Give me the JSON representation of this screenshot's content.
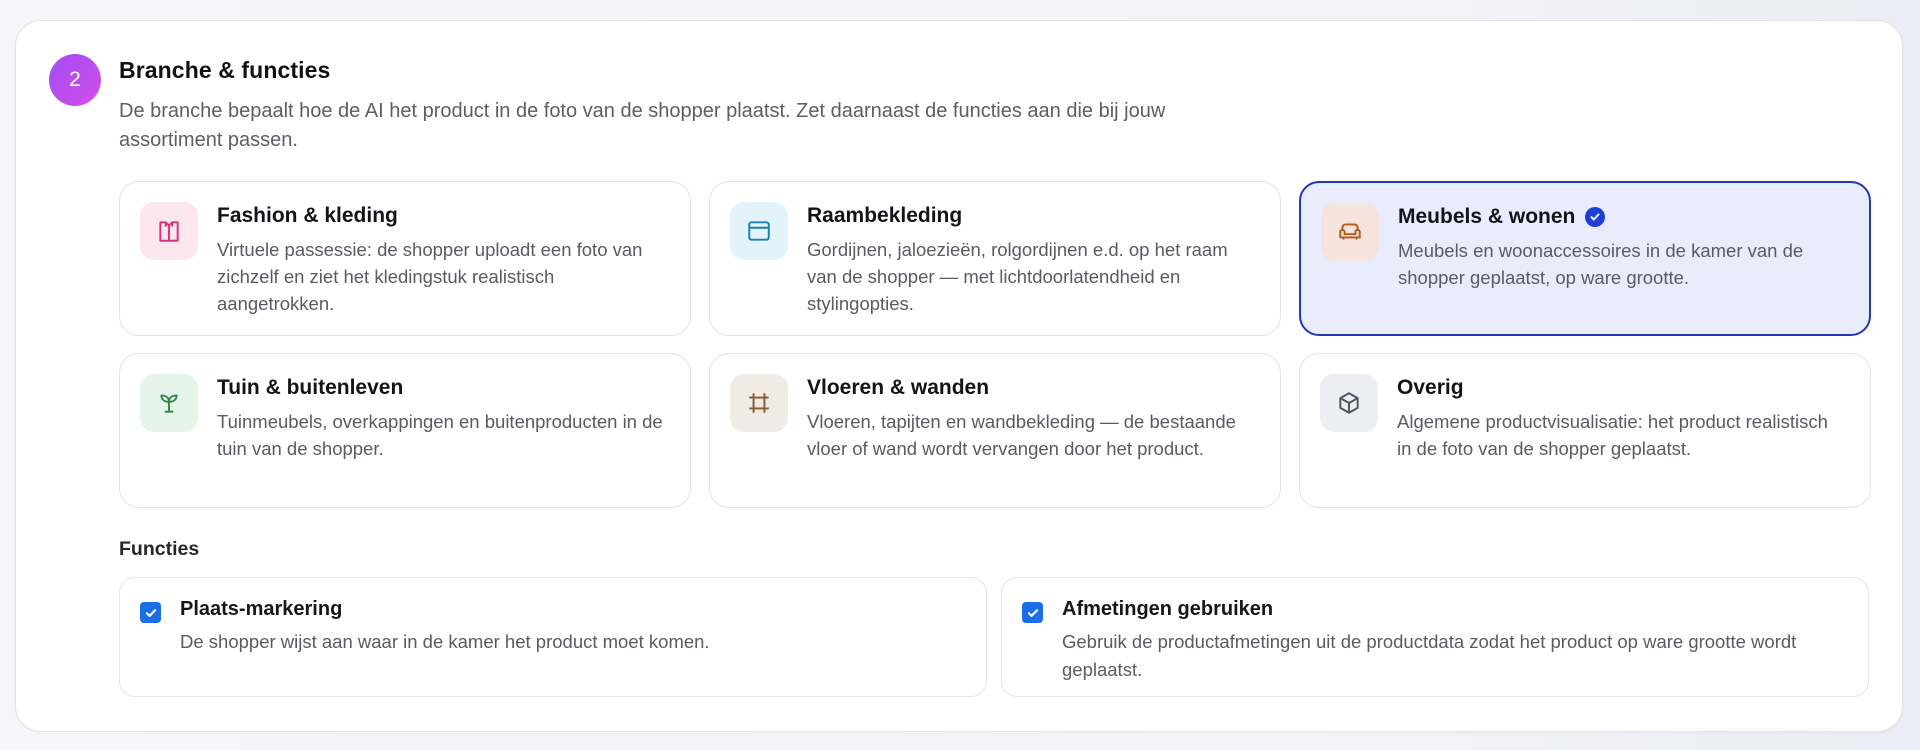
{
  "step": {
    "number": "2"
  },
  "section": {
    "title": "Branche & functies",
    "description": "De branche bepaalt hoe de AI het product in de foto van de shopper plaatst. Zet daarnaast de functies aan die bij jouw assortiment passen."
  },
  "branches": [
    {
      "id": "fashion",
      "title": "Fashion & kleding",
      "description": "Virtuele passessie: de shopper uploadt een foto van zichzelf en ziet het kledingstuk realistisch aangetrokken.",
      "icon": "shirt-icon",
      "icon_color": "#d6337a",
      "icon_bg": "#fde7ef",
      "selected": false
    },
    {
      "id": "raambekleding",
      "title": "Raambekleding",
      "description": "Gordijnen, jaloezieën, rolgordijnen e.d. op het raam van de shopper — met lichtdoorlatendheid en stylingopties.",
      "icon": "window-icon",
      "icon_color": "#1b7fb5",
      "icon_bg": "#e3f3fb",
      "selected": false
    },
    {
      "id": "meubels",
      "title": "Meubels & wonen",
      "description": "Meubels en woonaccessoires in de kamer van de shopper geplaatst, op ware grootte.",
      "icon": "sofa-icon",
      "icon_color": "#b45a1e",
      "icon_bg": "#f4e4dc",
      "selected": true
    },
    {
      "id": "tuin",
      "title": "Tuin & buitenleven",
      "description": "Tuinmeubels, overkappingen en buitenproducten in de tuin van de shopper.",
      "icon": "sprout-icon",
      "icon_color": "#2c8a4a",
      "icon_bg": "#e6f5ea",
      "selected": false
    },
    {
      "id": "vloeren",
      "title": "Vloeren & wanden",
      "description": "Vloeren, tapijten en wandbekleding — de bestaande vloer of wand wordt vervangen door het product.",
      "icon": "frame-icon",
      "icon_color": "#8a5a33",
      "icon_bg": "#f1ebe5",
      "selected": false
    },
    {
      "id": "overig",
      "title": "Overig",
      "description": "Algemene productvisualisatie: het product realistisch in de foto van de shopper geplaatst.",
      "icon": "box-icon",
      "icon_color": "#4e5461",
      "icon_bg": "#eceef1",
      "selected": false
    }
  ],
  "functies": {
    "label": "Functies",
    "items": [
      {
        "title": "Plaats-markering",
        "description": "De shopper wijst aan waar in de kamer het product moet komen.",
        "checked": true
      },
      {
        "title": "Afmetingen gebruiken",
        "description": "Gebruik de productafmetingen uit de productdata zodat het product op ware grootte wordt geplaatst.",
        "checked": true
      }
    ]
  },
  "colors": {
    "accent": "#1d3fd8",
    "selected_bg": "#e8ecfd",
    "checkbox": "#1b6ee8",
    "step_gradient_start": "#a24bf5",
    "step_gradient_end": "#d34fe6"
  }
}
